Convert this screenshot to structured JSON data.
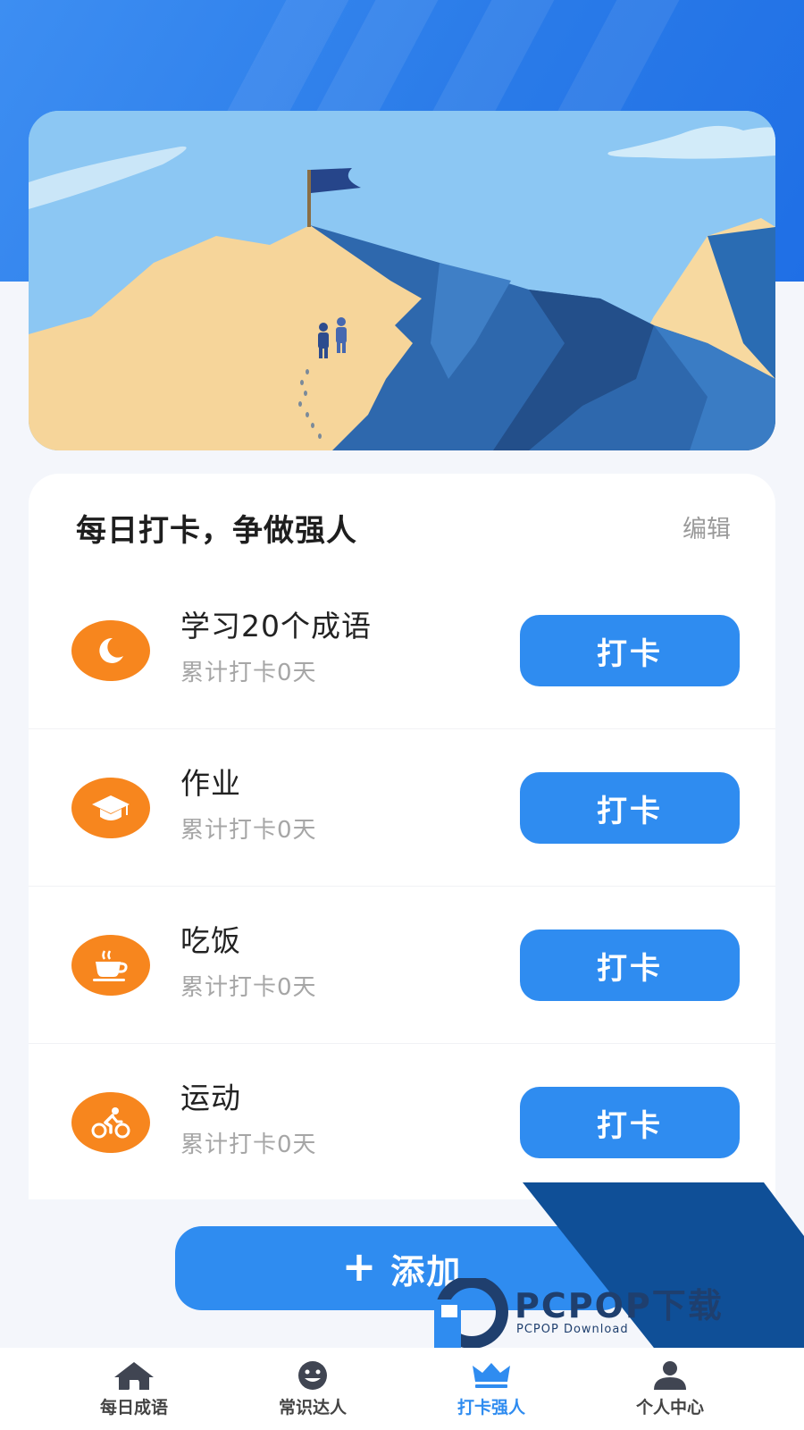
{
  "colors": {
    "accent": "#2f8cf0",
    "icon_bg": "#f7861e",
    "header_blue": "#2a7be8"
  },
  "card": {
    "title": "每日打卡，争做强人",
    "edit_label": "编辑"
  },
  "tasks": [
    {
      "name": "学习20个成语",
      "count": "累计打卡0天",
      "icon": "moon-sleep-icon",
      "button": "打卡"
    },
    {
      "name": "作业",
      "count": "累计打卡0天",
      "icon": "graduation-cap-icon",
      "button": "打卡"
    },
    {
      "name": "吃饭",
      "count": "累计打卡0天",
      "icon": "coffee-cup-icon",
      "button": "打卡"
    },
    {
      "name": "运动",
      "count": "累计打卡0天",
      "icon": "cyclist-icon",
      "button": "打卡"
    }
  ],
  "add_button": {
    "plus": "+",
    "label": "添加"
  },
  "watermark": {
    "brand": "PCPOP下载",
    "sub": "PCPOP Download"
  },
  "tabbar": {
    "items": [
      {
        "label": "每日成语",
        "icon": "home-icon",
        "active": false
      },
      {
        "label": "常识达人",
        "icon": "smiley-icon",
        "active": false
      },
      {
        "label": "打卡强人",
        "icon": "crown-icon",
        "active": true
      },
      {
        "label": "个人中心",
        "icon": "person-icon",
        "active": false
      }
    ]
  }
}
